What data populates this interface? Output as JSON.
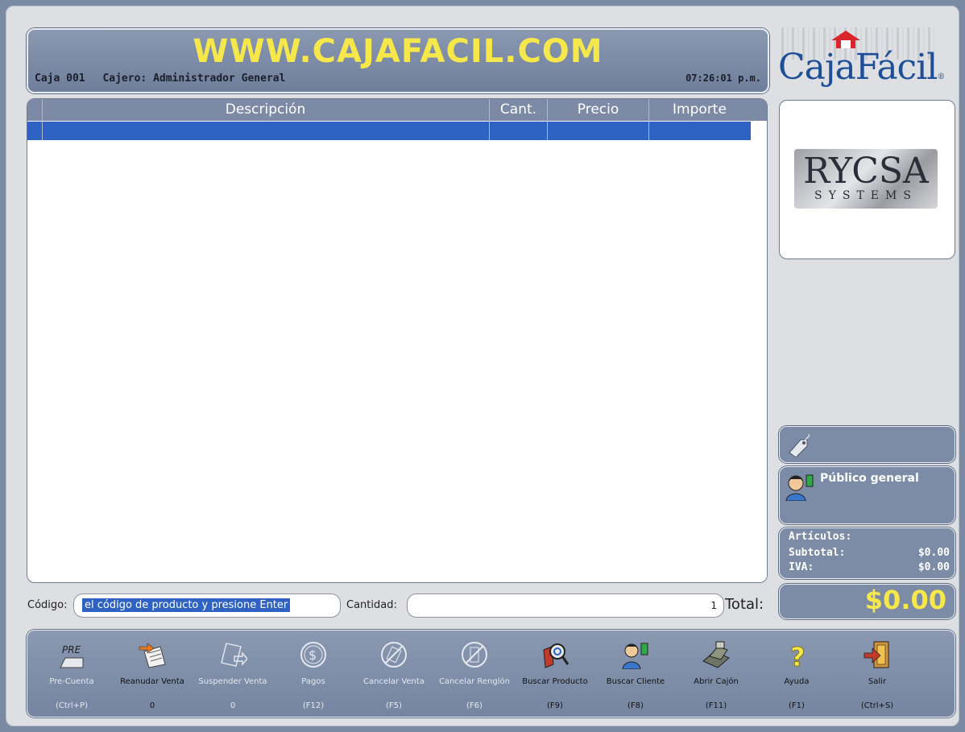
{
  "header": {
    "site_title": "WWW.CAJAFACIL.COM",
    "register": "Caja 001",
    "cashier": "Cajero: Administrador General",
    "clock": "07:26:01 p.m."
  },
  "brand": {
    "logo_text": "CajaFácil",
    "registered": "®"
  },
  "table": {
    "columns": [
      "Descripción",
      "Cant.",
      "Precio",
      "Importe"
    ]
  },
  "vendor_logo": {
    "name": "RYCSA",
    "subtitle": "SYSTEMS"
  },
  "customer": {
    "name": "Público general"
  },
  "totals": {
    "articles_label": "Artículos:",
    "subtotal_label": "Subtotal:",
    "subtotal_value": "$0.00",
    "iva_label": "IVA:",
    "iva_value": "$0.00",
    "total_label": "Total:",
    "total_value": "$0.00"
  },
  "inputs": {
    "code_label": "Código:",
    "code_value": "el código de producto y presione Enter",
    "qty_label": "Cantidad:",
    "qty_value": "1"
  },
  "toolbar": [
    {
      "label": "Pre-Cuenta",
      "count": "",
      "key": "(Ctrl+P)",
      "icon": "pre-icon",
      "enabled": false
    },
    {
      "label": "Reanudar Venta",
      "count": "0",
      "key": "",
      "icon": "resume-sale-icon",
      "enabled": true
    },
    {
      "label": "Suspender Venta",
      "count": "0",
      "key": "",
      "icon": "suspend-sale-icon",
      "enabled": false
    },
    {
      "label": "Pagos",
      "count": "",
      "key": "(F12)",
      "icon": "payments-icon",
      "enabled": false
    },
    {
      "label": "Cancelar Venta",
      "count": "",
      "key": "(F5)",
      "icon": "cancel-sale-icon",
      "enabled": false
    },
    {
      "label": "Cancelar Renglón",
      "count": "",
      "key": "(F6)",
      "icon": "cancel-line-icon",
      "enabled": false
    },
    {
      "label": "Buscar Producto",
      "count": "",
      "key": "(F9)",
      "icon": "search-product-icon",
      "enabled": true
    },
    {
      "label": "Buscar Cliente",
      "count": "",
      "key": "(F8)",
      "icon": "search-customer-icon",
      "enabled": true
    },
    {
      "label": "Abrir Cajón",
      "count": "",
      "key": "(F11)",
      "icon": "cash-drawer-icon",
      "enabled": true
    },
    {
      "label": "Ayuda",
      "count": "",
      "key": "(F1)",
      "icon": "help-icon",
      "enabled": true
    },
    {
      "label": "Salir",
      "count": "",
      "key": "(Ctrl+S)",
      "icon": "exit-icon",
      "enabled": true
    }
  ]
}
